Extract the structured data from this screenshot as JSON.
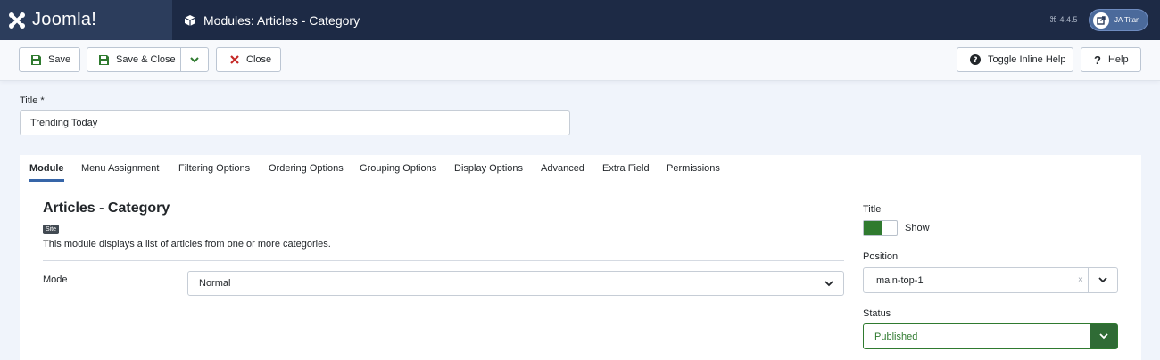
{
  "header": {
    "logo_text": "Joomla!",
    "title": "Modules: Articles - Category",
    "version": "⌘ 4.4.5",
    "site_button": "JA Titan"
  },
  "toolbar": {
    "save": "Save",
    "save_close": "Save & Close",
    "close": "Close",
    "toggle_help": "Toggle Inline Help",
    "help": "Help"
  },
  "form": {
    "title_label": "Title *",
    "title_value": "Trending Today"
  },
  "tabs": [
    "Module",
    "Menu Assignment",
    "Filtering Options",
    "Ordering Options",
    "Grouping Options",
    "Display Options",
    "Advanced",
    "Extra Field",
    "Permissions"
  ],
  "module": {
    "heading": "Articles - Category",
    "badge": "Site",
    "description": "This module displays a list of articles from one or more categories.",
    "mode_label": "Mode",
    "mode_value": "Normal"
  },
  "sidebar": {
    "title_label": "Title",
    "title_toggle": "Show",
    "position_label": "Position",
    "position_value": "main-top-1",
    "clear_symbol": "×",
    "status_label": "Status",
    "status_value": "Published"
  },
  "colors": {
    "header_bg": "#1d2a45",
    "accent_blue": "#3665a8",
    "success_green": "#2f7a2f",
    "close_red": "#c52827"
  }
}
